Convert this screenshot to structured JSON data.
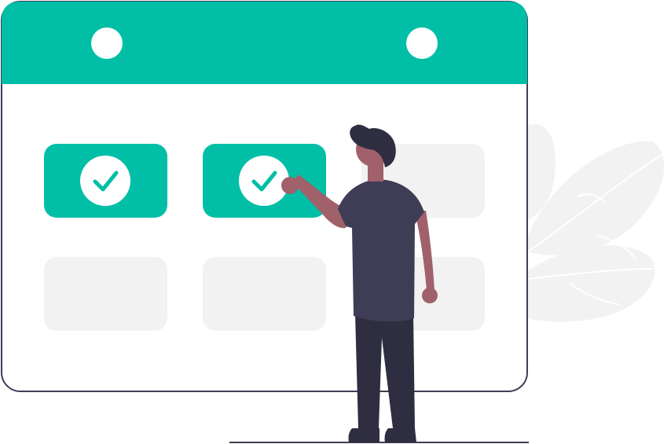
{
  "colors": {
    "accent": "#00BFA6",
    "cell_empty": "#F2F2F2",
    "leaf": "#F2F2F2",
    "outline": "#3F3D56",
    "shirt": "#3F3D56",
    "pants": "#2F2E41",
    "hair": "#2F2E41",
    "skin": "#A0616A",
    "check": "#00BFA6",
    "background": "#FFFFFF"
  },
  "icons": [
    "calendar-ring-icon",
    "check-icon"
  ],
  "calendar": {
    "cells": [
      {
        "name": "day-cell-1",
        "checked": true
      },
      {
        "name": "day-cell-2",
        "checked": true
      },
      {
        "name": "day-cell-3",
        "checked": false
      },
      {
        "name": "day-cell-4",
        "checked": false
      },
      {
        "name": "day-cell-5",
        "checked": false
      },
      {
        "name": "day-cell-6",
        "checked": false
      }
    ]
  }
}
